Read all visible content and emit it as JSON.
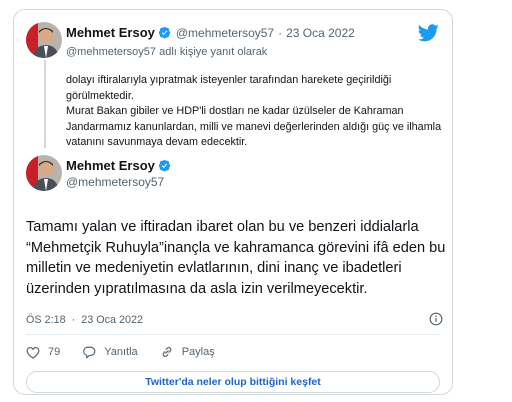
{
  "colors": {
    "brand": "#1d9bf0",
    "text": "#0f1419",
    "muted": "#536471",
    "link": "#1d63c9",
    "border": "#cfd9de"
  },
  "parent": {
    "display_name": "Mehmet Ersoy",
    "handle": "@mehmetersoy57",
    "separator": "·",
    "date": "23 Oca 2022",
    "reply_context": "@mehmetersoy57 adlı kişiye yanıt olarak",
    "paragraphs": [
      "dolayı iftiralarıyla yıpratmak isteyenler tarafından harekete geçirildiği görülmektedir.",
      "Murat Bakan gibiler ve HDP'li dostları ne kadar üzülseler de Kahraman Jandarmamız kanunlardan, milli ve manevi değerlerinden aldığı güç ve ilhamla vatanını savunmaya devam edecektir."
    ]
  },
  "main": {
    "display_name": "Mehmet Ersoy",
    "handle": "@mehmetersoy57",
    "text": "Tamamı yalan ve iftiradan ibaret olan bu ve benzeri iddialarla “Mehmetçik Ruhuyla”inançla ve kahramanca görevini ifâ eden bu milletin ve medeniyetin evlatlarının, dini inanç ve ibadetleri üzerinden yıpratılmasına da asla izin verilmeyecektir.",
    "time": "ÖS 2:18",
    "separator": "·",
    "date": "23 Oca 2022"
  },
  "actions": {
    "likes": "79",
    "reply_label": "Yanıtla",
    "share_label": "Paylaş"
  },
  "cta_label": "Twitter'da neler olup bittiğini keşfet",
  "icons": [
    "twitter-bird-icon",
    "verified-badge-icon",
    "heart-icon",
    "reply-icon",
    "share-icon",
    "info-icon"
  ]
}
